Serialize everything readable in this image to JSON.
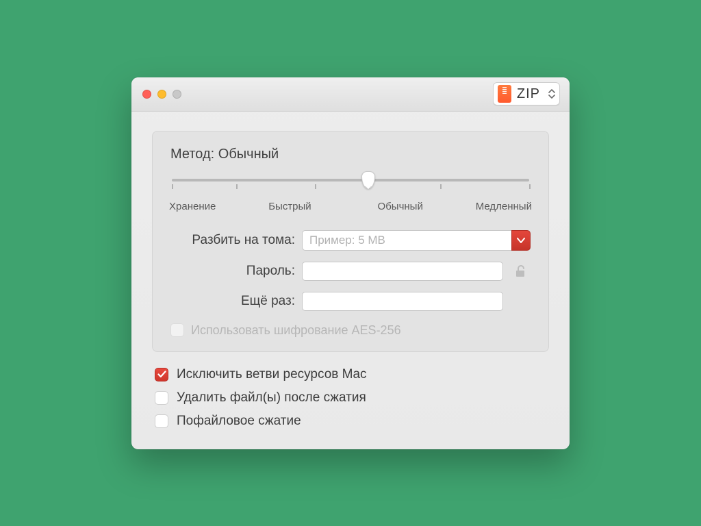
{
  "titlebar": {
    "format_label": "ZIP"
  },
  "panel": {
    "method_prefix": "Метод:",
    "method_value": "Обычный",
    "slider": {
      "labels": [
        "Хранение",
        "Быстрый",
        "Обычный",
        "Медленный"
      ],
      "position_percent": 55
    },
    "volumes": {
      "label": "Разбить на тома:",
      "placeholder": "Пример: 5 MB",
      "value": ""
    },
    "password": {
      "label": "Пароль:",
      "value": ""
    },
    "password_repeat": {
      "label": "Ещё раз:",
      "value": ""
    },
    "aes": {
      "label": "Использовать шифрование AES-256",
      "checked": false,
      "enabled": false
    }
  },
  "options": {
    "exclude_mac": {
      "label": "Исключить ветви ресурсов Mac",
      "checked": true
    },
    "delete_after": {
      "label": "Удалить файл(ы) после сжатия",
      "checked": false
    },
    "per_file": {
      "label": "Пофайловое сжатие",
      "checked": false
    }
  }
}
